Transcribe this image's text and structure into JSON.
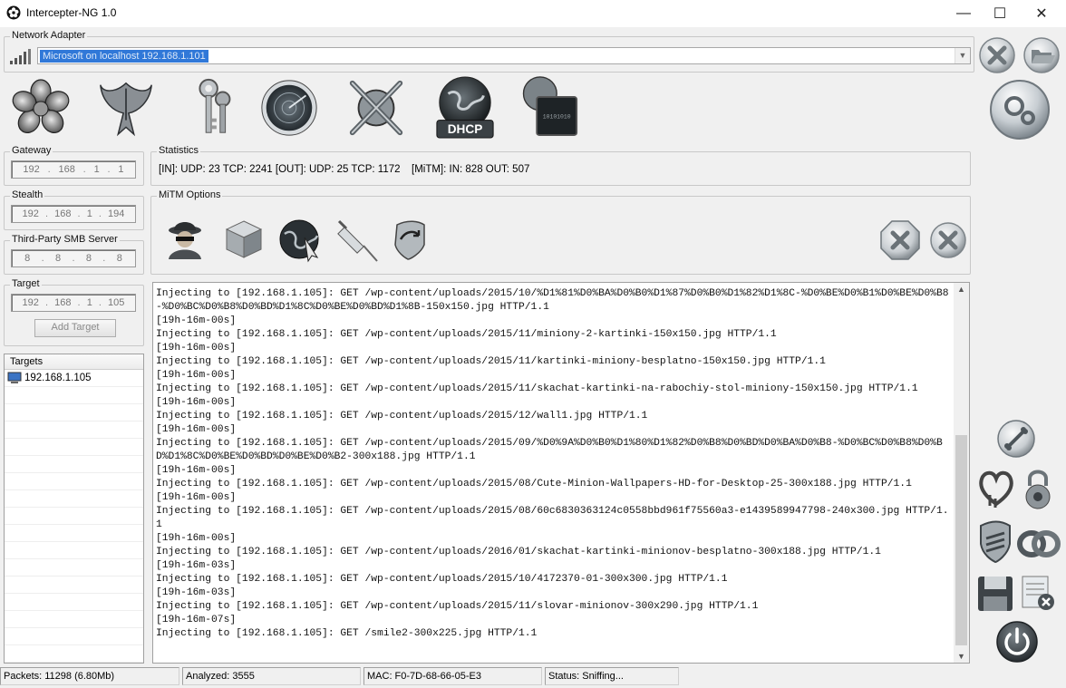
{
  "window": {
    "title": "Intercepter-NG 1.0",
    "minimize": "—",
    "maximize": "☐",
    "close": "✕"
  },
  "network_adapter": {
    "label": "Network Adapter",
    "value": "Microsoft on localhost 192.168.1.101"
  },
  "toolbar_icons": [
    "flower-icon",
    "phoenix-icon",
    "keys-icon",
    "radar-icon",
    "crossed-tools-icon",
    "dhcp-icon",
    "network-card-icon"
  ],
  "dhcp_label": "DHCP",
  "gateway": {
    "label": "Gateway",
    "ip": [
      "192",
      "168",
      "1",
      "1"
    ]
  },
  "stealth": {
    "label": "Stealth",
    "ip": [
      "192",
      "168",
      "1",
      "194"
    ]
  },
  "smb": {
    "label": "Third-Party SMB Server",
    "ip": [
      "8",
      "8",
      "8",
      "8"
    ]
  },
  "target": {
    "label": "Target",
    "ip": [
      "192",
      "168",
      "1",
      "105"
    ],
    "add_button": "Add Target"
  },
  "targets": {
    "header": "Targets",
    "items": [
      "192.168.1.105"
    ]
  },
  "statistics": {
    "label": "Statistics",
    "traffic": "[IN]: UDP: 23 TCP: 2241 [OUT]: UDP: 25 TCP: 1172",
    "mitm": "[MiTM]: IN: 828 OUT: 507"
  },
  "mitm_options": {
    "label": "MiTM Options"
  },
  "log_lines": [
    "Injecting to [192.168.1.105]: GET /wp-content/uploads/2015/10/%D1%81%D0%BA%D0%B0%D1%87%D0%B0%D1%82%D1%8C-%D0%BE%D0%B1%D0%BE%D0%B8-%D0%BC%D0%B8%D0%BD%D1%8C%D0%BE%D0%BD%D1%8B-150x150.jpg HTTP/1.1",
    "[19h-16m-00s]",
    "Injecting to [192.168.1.105]: GET /wp-content/uploads/2015/11/miniony-2-kartinki-150x150.jpg HTTP/1.1",
    "[19h-16m-00s]",
    "Injecting to [192.168.1.105]: GET /wp-content/uploads/2015/11/kartinki-miniony-besplatno-150x150.jpg HTTP/1.1",
    "[19h-16m-00s]",
    "Injecting to [192.168.1.105]: GET /wp-content/uploads/2015/11/skachat-kartinki-na-rabochiy-stol-miniony-150x150.jpg HTTP/1.1",
    "[19h-16m-00s]",
    "Injecting to [192.168.1.105]: GET /wp-content/uploads/2015/12/wall1.jpg HTTP/1.1",
    "[19h-16m-00s]",
    "Injecting to [192.168.1.105]: GET /wp-content/uploads/2015/09/%D0%9A%D0%B0%D1%80%D1%82%D0%B8%D0%BD%D0%BA%D0%B8-%D0%BC%D0%B8%D0%BD%D1%8C%D0%BE%D0%BD%D0%BE%D0%B2-300x188.jpg HTTP/1.1",
    "[19h-16m-00s]",
    "Injecting to [192.168.1.105]: GET /wp-content/uploads/2015/08/Cute-Minion-Wallpapers-HD-for-Desktop-25-300x188.jpg HTTP/1.1",
    "[19h-16m-00s]",
    "Injecting to [192.168.1.105]: GET /wp-content/uploads/2015/08/60c6830363124c0558bbd961f75560a3-e1439589947798-240x300.jpg HTTP/1.1",
    "[19h-16m-00s]",
    "Injecting to [192.168.1.105]: GET /wp-content/uploads/2016/01/skachat-kartinki-minionov-besplatno-300x188.jpg HTTP/1.1",
    "[19h-16m-03s]",
    "Injecting to [192.168.1.105]: GET /wp-content/uploads/2015/10/4172370-01-300x300.jpg HTTP/1.1",
    "[19h-16m-03s]",
    "Injecting to [192.168.1.105]: GET /wp-content/uploads/2015/11/slovar-minionov-300x290.jpg HTTP/1.1",
    "[19h-16m-07s]",
    "Injecting to [192.168.1.105]: GET /smile2-300x225.jpg HTTP/1.1"
  ],
  "status": {
    "packets": "Packets: 11298 (6.80Mb)",
    "analyzed": "Analyzed: 3555",
    "mac": "MAC: F0-7D-68-66-05-E3",
    "state": "Status: Sniffing..."
  }
}
